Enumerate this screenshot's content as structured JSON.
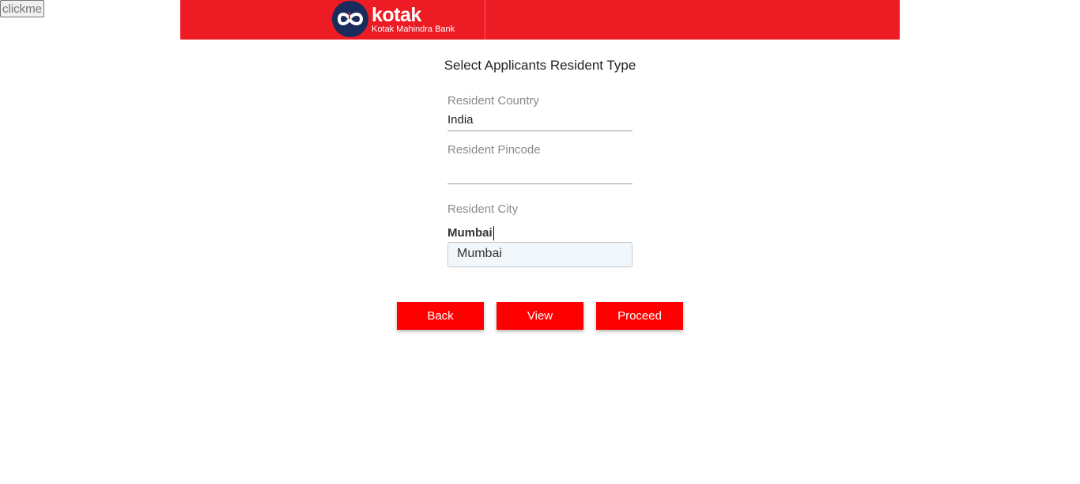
{
  "clickme_label": "clickme",
  "logo": {
    "brand": "kotak",
    "subtitle": "Kotak Mahindra Bank"
  },
  "page_title": "Select Applicants Resident Type",
  "fields": {
    "country": {
      "label": "Resident Country",
      "value": "India"
    },
    "pincode": {
      "label": "Resident Pincode",
      "value": ""
    },
    "city": {
      "label": "Resident City",
      "value": "Mumbai"
    }
  },
  "city_suggestions": [
    "Mumbai"
  ],
  "buttons": {
    "back": "Back",
    "view": "View",
    "proceed": "Proceed"
  }
}
